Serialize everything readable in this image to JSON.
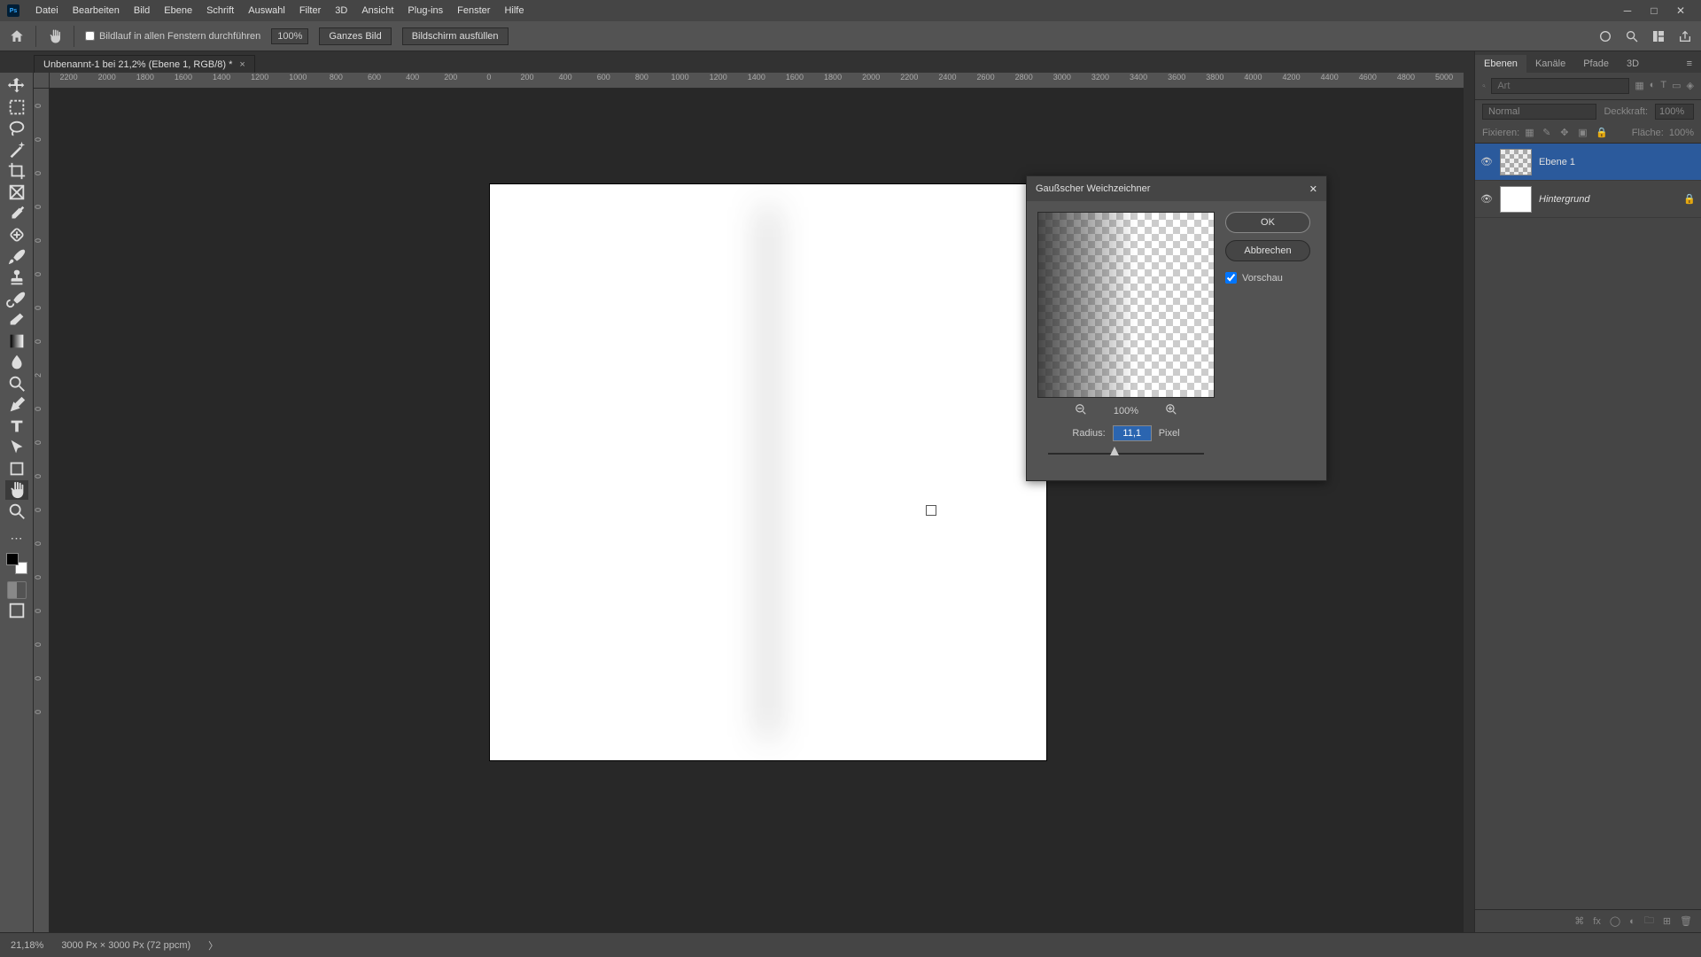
{
  "menu": {
    "items": [
      "Datei",
      "Bearbeiten",
      "Bild",
      "Ebene",
      "Schrift",
      "Auswahl",
      "Filter",
      "3D",
      "Ansicht",
      "Plug-ins",
      "Fenster",
      "Hilfe"
    ]
  },
  "options": {
    "scroll_label": "Bildlauf in allen Fenstern durchführen",
    "zoom_pct": "100%",
    "btn1": "Ganzes Bild",
    "btn2": "Bildschirm ausfüllen"
  },
  "doc_tab": {
    "title": "Unbenannt-1 bei 21,2% (Ebene 1, RGB/8) *"
  },
  "ruler_h": [
    "2200",
    "2000",
    "1800",
    "1600",
    "1400",
    "1200",
    "1000",
    "800",
    "600",
    "400",
    "200",
    "0",
    "200",
    "400",
    "600",
    "800",
    "1000",
    "1200",
    "1400",
    "1600",
    "1800",
    "2000",
    "2200",
    "2400",
    "2600",
    "2800",
    "3000",
    "3200",
    "3400",
    "3600",
    "3800",
    "4000",
    "4200",
    "4400",
    "4600",
    "4800",
    "5000"
  ],
  "ruler_v": [
    "0",
    "0",
    "0",
    "0",
    "0",
    "0",
    "0",
    "0",
    "2",
    "0",
    "0",
    "0",
    "0",
    "0",
    "0",
    "0",
    "0",
    "0",
    "0"
  ],
  "dialog": {
    "title": "Gaußscher Weichzeichner",
    "ok": "OK",
    "cancel": "Abbrechen",
    "preview": "Vorschau",
    "zoom_pct": "100%",
    "radius_label": "Radius:",
    "radius_value": "11,1",
    "radius_unit": "Pixel"
  },
  "panels": {
    "tabs": [
      "Ebenen",
      "Kanäle",
      "Pfade",
      "3D"
    ],
    "search_placeholder": "Art",
    "blend_mode": "Normal",
    "opacity_label": "Deckkraft:",
    "opacity_value": "100%",
    "fix_label": "Fixieren:",
    "fill_label": "Fläche:",
    "fill_value": "100%"
  },
  "layers": [
    {
      "name": "Ebene 1",
      "active": true,
      "transparent": true,
      "locked": false
    },
    {
      "name": "Hintergrund",
      "active": false,
      "transparent": false,
      "locked": true
    }
  ],
  "status": {
    "zoom": "21,18%",
    "doc": "3000 Px × 3000 Px (72 ppcm)"
  }
}
